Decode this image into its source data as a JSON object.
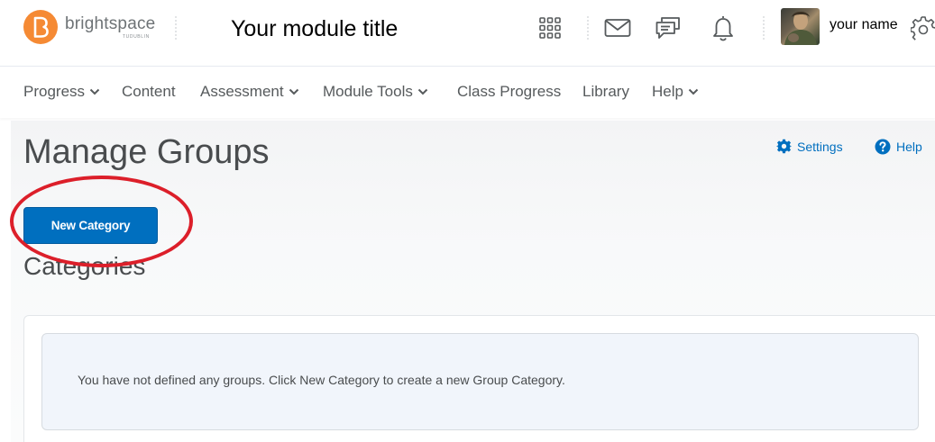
{
  "header": {
    "brand": "brightspace",
    "brand_sub": "TUDUBLIN",
    "module_title": "Your module title",
    "user_name": "your name",
    "icons": [
      "waffle-icon",
      "mail-icon",
      "chat-icon",
      "bell-icon",
      "gear-icon"
    ]
  },
  "nav": {
    "items": [
      {
        "label": "Progress",
        "dropdown": true
      },
      {
        "label": "Content",
        "dropdown": false
      },
      {
        "label": "Assessment",
        "dropdown": true
      },
      {
        "label": "Module Tools",
        "dropdown": true
      },
      {
        "label": "Class Progress",
        "dropdown": false
      },
      {
        "label": "Library",
        "dropdown": false
      },
      {
        "label": "Help",
        "dropdown": true
      }
    ]
  },
  "page": {
    "title": "Manage Groups",
    "settings_label": "Settings",
    "help_label": "Help",
    "new_category_label": "New Category",
    "categories_heading": "Categories",
    "empty_message": "You have not defined any groups. Click New Category to create a new Group Category."
  },
  "colors": {
    "accent": "#006fbf",
    "brand": "#f58a34",
    "annotation": "#dc1f2a"
  }
}
